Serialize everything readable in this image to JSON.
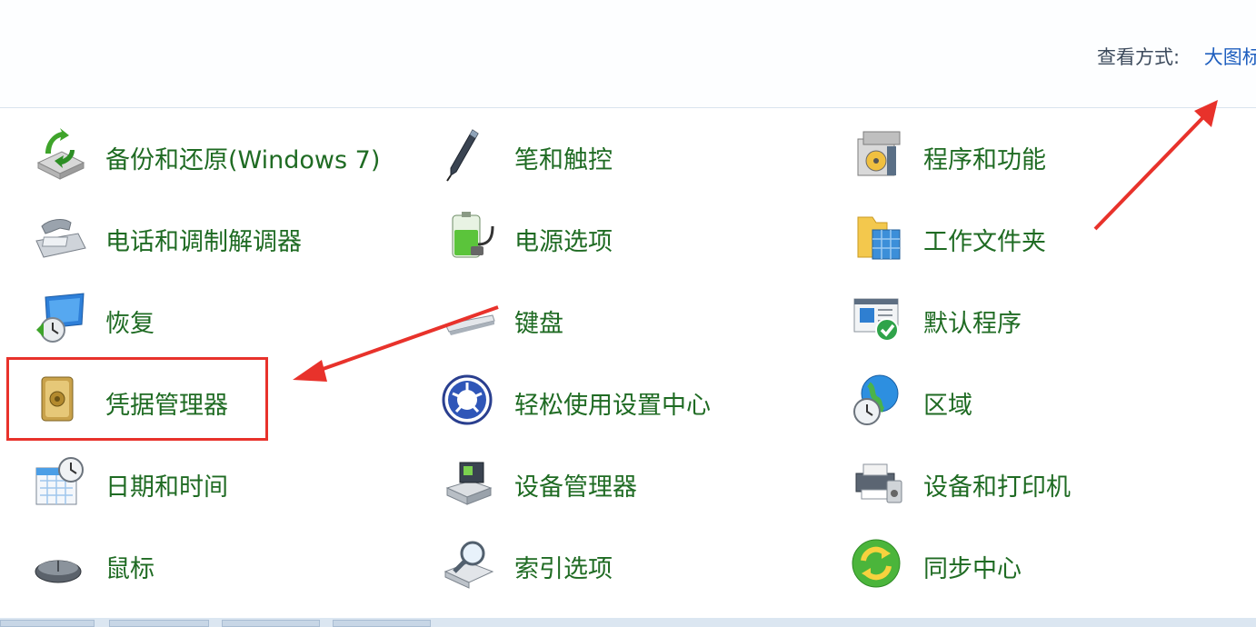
{
  "header": {
    "view_by_label": "查看方式:",
    "view_mode": "大图标"
  },
  "items": [
    {
      "label": "备份和还原(Windows 7)",
      "icon": "backup-restore-icon"
    },
    {
      "label": "笔和触控",
      "icon": "pen-touch-icon"
    },
    {
      "label": "程序和功能",
      "icon": "programs-features-icon"
    },
    {
      "label": "电话和调制解调器",
      "icon": "phone-modem-icon"
    },
    {
      "label": "电源选项",
      "icon": "power-options-icon"
    },
    {
      "label": "工作文件夹",
      "icon": "work-folders-icon"
    },
    {
      "label": "恢复",
      "icon": "recovery-icon"
    },
    {
      "label": "键盘",
      "icon": "keyboard-icon"
    },
    {
      "label": "默认程序",
      "icon": "default-programs-icon"
    },
    {
      "label": "凭据管理器",
      "icon": "credential-manager-icon"
    },
    {
      "label": "轻松使用设置中心",
      "icon": "ease-of-access-icon"
    },
    {
      "label": "区域",
      "icon": "region-icon"
    },
    {
      "label": "日期和时间",
      "icon": "date-time-icon"
    },
    {
      "label": "设备管理器",
      "icon": "device-manager-icon"
    },
    {
      "label": "设备和打印机",
      "icon": "devices-printers-icon"
    },
    {
      "label": "鼠标",
      "icon": "mouse-icon"
    },
    {
      "label": "索引选项",
      "icon": "indexing-options-icon"
    },
    {
      "label": "同步中心",
      "icon": "sync-center-icon"
    }
  ],
  "colors": {
    "label": "#1f6b23",
    "link": "#1f5fbf",
    "annotation": "#e8322b"
  }
}
